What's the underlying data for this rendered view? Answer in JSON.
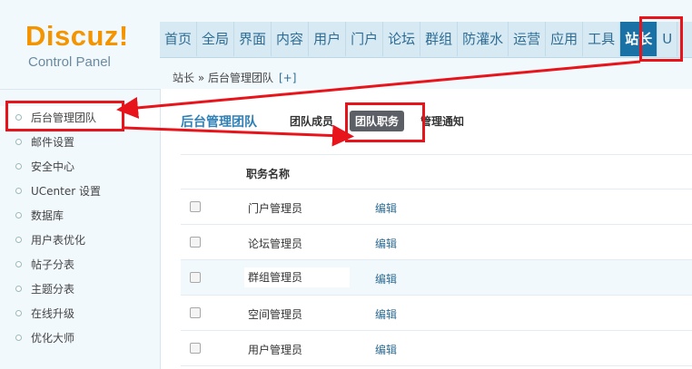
{
  "logo": {
    "brand": "Discuz!",
    "subtitle": "Control Panel"
  },
  "topnav": [
    "首页",
    "全局",
    "界面",
    "内容",
    "用户",
    "门户",
    "论坛",
    "群组",
    "防灌水",
    "运营",
    "应用",
    "工具",
    "站长",
    "U"
  ],
  "topnav_active": "站长",
  "breadcrumb": {
    "path": "站长 » 后台管理团队",
    "add": "[+]"
  },
  "sidebar": {
    "items": [
      {
        "label": "后台管理团队"
      },
      {
        "label": "邮件设置"
      },
      {
        "label": "安全中心"
      },
      {
        "label": "UCenter 设置"
      },
      {
        "label": "数据库"
      },
      {
        "label": "用户表优化"
      },
      {
        "label": "帖子分表"
      },
      {
        "label": "主题分表"
      },
      {
        "label": "在线升级"
      },
      {
        "label": "优化大师"
      }
    ]
  },
  "subtabs": {
    "title": "后台管理团队",
    "tabs": [
      "团队成员",
      "团队职务",
      "管理通知"
    ],
    "active": "团队职务"
  },
  "table": {
    "header": "职务名称",
    "rows": [
      {
        "name": "门户管理员",
        "action": "编辑"
      },
      {
        "name": "论坛管理员",
        "action": "编辑"
      },
      {
        "name": "群组管理员",
        "action": "编辑"
      },
      {
        "name": "空间管理员",
        "action": "编辑"
      },
      {
        "name": "用户管理员",
        "action": "编辑"
      }
    ]
  },
  "colors": {
    "annotation": "#e8141b",
    "accent": "#1a71a6",
    "brand": "#f39400"
  }
}
